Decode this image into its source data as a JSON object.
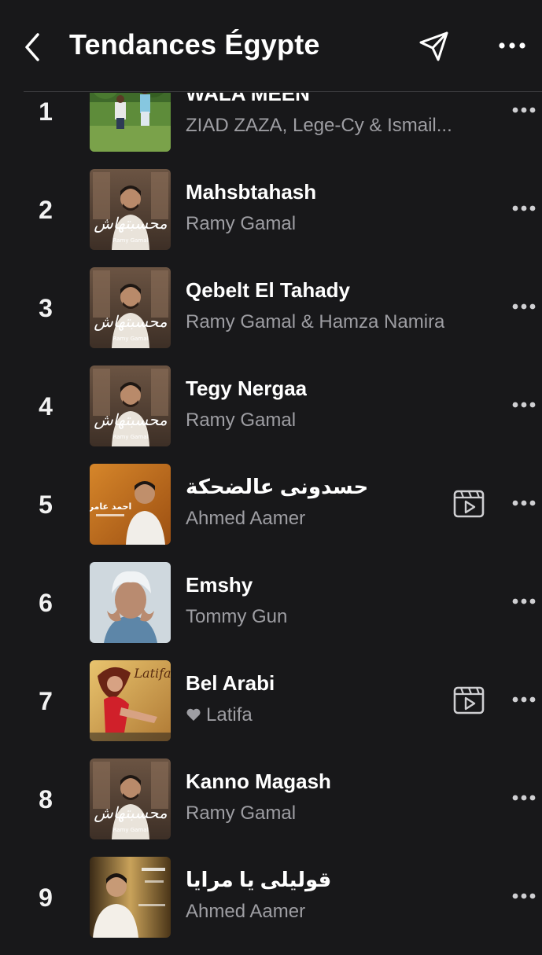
{
  "header": {
    "title": "Tendances Égypte"
  },
  "tracks": [
    {
      "rank": "1",
      "title": "WALA MEEN",
      "artist": "ZIAD ZAZA, Lege-Cy & Ismail...",
      "cover": "field",
      "video": false,
      "liked": false
    },
    {
      "rank": "2",
      "title": "Mahsbtahash",
      "artist": "Ramy Gamal",
      "cover": "ramy",
      "video": false,
      "liked": false
    },
    {
      "rank": "3",
      "title": "Qebelt El Tahady",
      "artist": "Ramy Gamal & Hamza Namira",
      "cover": "ramy",
      "video": false,
      "liked": false
    },
    {
      "rank": "4",
      "title": "Tegy Nergaa",
      "artist": "Ramy Gamal",
      "cover": "ramy",
      "video": false,
      "liked": false
    },
    {
      "rank": "5",
      "title": "حسدونى عالضحكة",
      "artist": "Ahmed Aamer",
      "cover": "orange",
      "video": true,
      "liked": false
    },
    {
      "rank": "6",
      "title": "Emshy",
      "artist": "Tommy Gun",
      "cover": "blue",
      "video": false,
      "liked": false
    },
    {
      "rank": "7",
      "title": "Bel Arabi",
      "artist": "Latifa",
      "cover": "red",
      "video": true,
      "liked": true
    },
    {
      "rank": "8",
      "title": "Kanno Magash",
      "artist": "Ramy Gamal",
      "cover": "ramy",
      "video": false,
      "liked": false
    },
    {
      "rank": "9",
      "title": "قوليلى يا مرايا",
      "artist": "Ahmed Aamer",
      "cover": "gold",
      "video": false,
      "liked": false
    }
  ],
  "cover_texts": {
    "ramy": "محسبتهاش",
    "ramy_small": "Ramy Gamal",
    "orange": "احمد عامر",
    "red": "Latifa"
  },
  "colors": {
    "background": "#18181a",
    "text_primary": "#ffffff",
    "text_secondary": "#9e9ea3",
    "divider": "#3a3a3d"
  },
  "icons": {
    "back": "chevron-left-icon",
    "share": "paper-plane-icon",
    "more": "ellipsis-icon",
    "video": "music-video-icon",
    "liked": "heart-icon"
  }
}
